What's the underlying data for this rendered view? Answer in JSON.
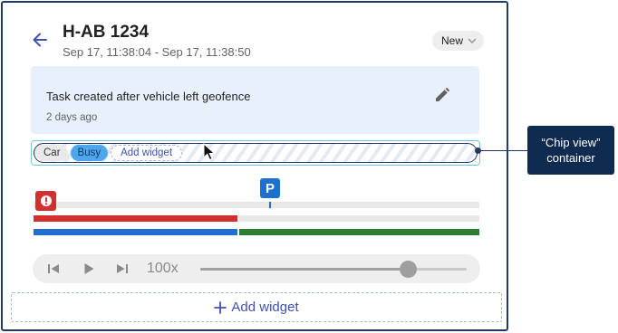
{
  "header": {
    "title": "H-AB 1234",
    "subtitle": "Sep 17, 11:38:04 - Sep 17, 11:38:50",
    "status_label": "New"
  },
  "info": {
    "message": "Task created after vehicle left geofence",
    "time_ago": "2 days ago"
  },
  "chips": [
    {
      "label": "Car"
    },
    {
      "label": "Busy"
    },
    {
      "label": "Add widget"
    }
  ],
  "timeline": {
    "parking_label": "P",
    "parking_position": 0.53,
    "red_bar_fraction": 0.457,
    "blue_bar_fraction": 0.457
  },
  "player": {
    "speed": "100x",
    "progress": 0.78
  },
  "footer": {
    "add_widget_label": "Add widget"
  },
  "annotation": {
    "line1": "“Chip view”",
    "line2": "container"
  },
  "colors": {
    "accent": "#3f51b5",
    "alert_red": "#d32f2f",
    "route_blue": "#1e6fd0",
    "route_green": "#2e7d32",
    "chip_busy": "#4ea7ec",
    "callout_bg": "#0f2b4f"
  },
  "icons": [
    "back-arrow-icon",
    "chevron-down-icon",
    "pencil-icon",
    "alert-icon",
    "parking-icon",
    "skip-previous-icon",
    "play-icon",
    "skip-next-icon",
    "plus-icon",
    "cursor-icon"
  ]
}
